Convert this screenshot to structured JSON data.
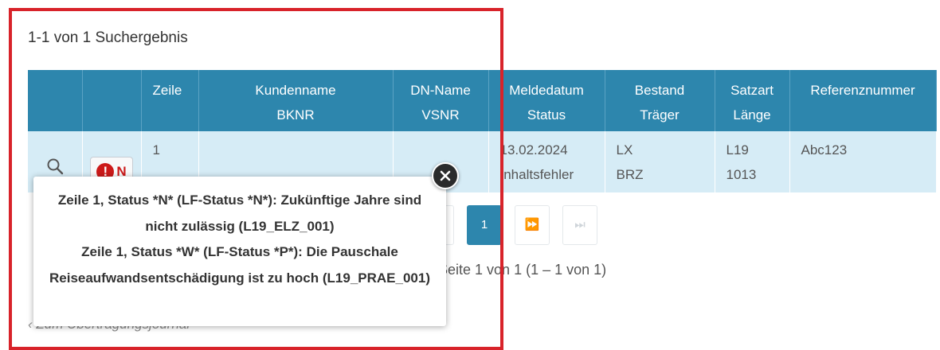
{
  "result_count": "1-1 von 1 Suchergebnis",
  "table": {
    "headers": {
      "zeile": "Zeile",
      "kundenname": "Kundenname",
      "bknr": "BKNR",
      "dn_name": "DN-Name",
      "vsnr": "VSNR",
      "meldedatum": "Meldedatum",
      "status": "Status",
      "bestand": "Bestand",
      "traeger": "Träger",
      "satzart": "Satzart",
      "laenge": "Länge",
      "referenznummer": "Referenznummer"
    },
    "row": {
      "status_icon": "!",
      "status_code": "N",
      "zeile": "1",
      "kundenname": "",
      "bknr": "",
      "dn_name": "",
      "vsnr": "",
      "meldedatum": "13.02.2024",
      "status": "Inhaltsfehler",
      "bestand": "LX",
      "traeger": "BRZ",
      "satzart": "L19",
      "laenge": "1013",
      "referenznummer": "Abc123"
    }
  },
  "tooltip": {
    "message_1": "Zeile 1, Status *N* (LF-Status *N*): Zukünftige Jahre sind nicht zulässig (L19_ELZ_001)",
    "message_2": "Zeile 1, Status *W* (LF-Status *P*): Die Pauschale Reiseaufwandsentschädigung ist zu hoch (L19_PRAE_001)"
  },
  "pagination": {
    "current_page": "1",
    "next_icon": "⏩",
    "last_icon": "⏭",
    "info": "Seite 1 von 1 (1 – 1 von 1)"
  },
  "back_link": "Zum Übertragungsjournal",
  "colors": {
    "header_bg": "#2d86ad",
    "row_bg": "#d6ecf6",
    "error_red": "#cc1a1a",
    "highlight_frame": "#d8232a"
  }
}
